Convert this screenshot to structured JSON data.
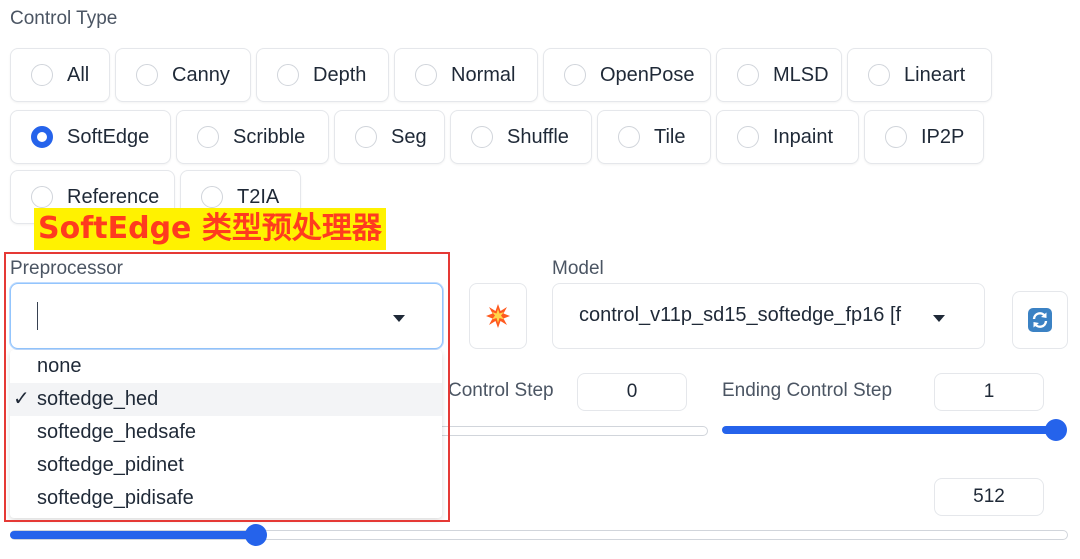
{
  "control_type": {
    "label": "Control Type",
    "selected": "SoftEdge",
    "row1": [
      "All",
      "Canny",
      "Depth",
      "Normal",
      "OpenPose",
      "MLSD",
      "Lineart"
    ],
    "row2": [
      "SoftEdge",
      "Scribble",
      "Seg",
      "Shuffle",
      "Tile",
      "Inpaint",
      "IP2P"
    ],
    "row3": [
      "Reference",
      "T2IA"
    ]
  },
  "annotation": {
    "text": "SoftEdge 类型预处理器",
    "text_color": "#ff3b1f",
    "highlight_color": "#fff200",
    "box_color": "#e53935"
  },
  "preprocessor": {
    "label": "Preprocessor",
    "value": "",
    "options": [
      "none",
      "softedge_hed",
      "softedge_hedsafe",
      "softedge_pidinet",
      "softedge_pidisafe"
    ],
    "selected": "softedge_hed",
    "check_mark": "✓"
  },
  "run_preprocessor_icon": "explosion-icon",
  "model": {
    "label": "Model",
    "value": "control_v11p_sd15_softedge_fp16 [f"
  },
  "refresh_icon": "refresh-icon",
  "starting_control_step": {
    "label_visible": "Control Step",
    "value": "0",
    "slider_fraction": 0
  },
  "ending_control_step": {
    "label": "Ending Control Step",
    "value": "1",
    "slider_fraction": 1
  },
  "resolution": {
    "value": "512",
    "slider_fraction": 0.23
  },
  "accent_color": "#2563eb"
}
